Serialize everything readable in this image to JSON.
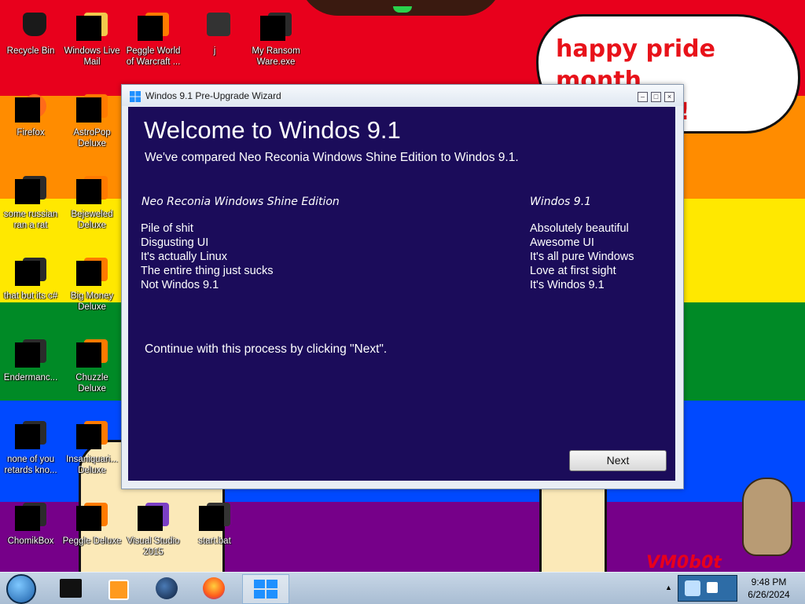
{
  "desktop": {
    "wallpaper_colors": [
      "#e8001c",
      "#ff8c00",
      "#ffe800",
      "#008a26",
      "#0049ff",
      "#760089"
    ],
    "icons": [
      {
        "label": "Recycle Bin",
        "icon": "recycle-bin-icon"
      },
      {
        "label": "Windows Live Mail",
        "icon": "mail-icon"
      },
      {
        "label": "Peggle World of Warcraft ...",
        "icon": "game-icon"
      },
      {
        "label": "j",
        "icon": "folder-icon"
      },
      {
        "label": "My Ransom Ware.exe",
        "icon": "program-icon"
      },
      {
        "label": "Firefox",
        "icon": "firefox-icon"
      },
      {
        "label": "AstroPop Deluxe",
        "icon": "game-icon"
      },
      {
        "label": "some russian ran a rat",
        "icon": "program-icon"
      },
      {
        "label": "Bejeweled Deluxe",
        "icon": "game-icon"
      },
      {
        "label": "that but its c#",
        "icon": "program-icon"
      },
      {
        "label": "Big Money Deluxe",
        "icon": "game-icon"
      },
      {
        "label": "Endermanc...",
        "icon": "program-icon"
      },
      {
        "label": "Chuzzle Deluxe",
        "icon": "game-icon"
      },
      {
        "label": "none of you retards kno...",
        "icon": "program-icon"
      },
      {
        "label": "Insaniquari... Deluxe",
        "icon": "game-icon"
      },
      {
        "label": "ChomikBox",
        "icon": "program-icon"
      },
      {
        "label": "Peggle Deluxe",
        "icon": "game-icon"
      },
      {
        "label": "Visual Studio 2015",
        "icon": "visual-studio-icon"
      },
      {
        "label": "start.bat",
        "icon": "batch-file-icon"
      }
    ],
    "bubble_text": "happy pride month everyone!",
    "watermark": "VM0b0t"
  },
  "wizard": {
    "title": "Windos 9.1 Pre-Upgrade Wizard",
    "heading": "Welcome to Windos 9.1",
    "subtitle": "We've compared Neo Reconia Windows Shine Edition  to Windos 9.1.",
    "left_header": "Neo Reconia Windows Shine Edition",
    "left_items": [
      "Pile of shit",
      "Disgusting UI",
      "It's actually Linux",
      "The entire thing just sucks",
      "Not Windos 9.1"
    ],
    "right_header": "Windos 9.1",
    "right_items": [
      "Absolutely beautiful",
      "Awesome UI",
      "It's all pure Windows",
      "Love at first sight",
      "It's Windos 9.1"
    ],
    "continue_text": "Continue with this process by clicking \"Next\".",
    "next_label": "Next",
    "bg_color": "#1b0c5a"
  },
  "taskbar": {
    "time": "9:48 PM",
    "date": "6/26/2024"
  }
}
